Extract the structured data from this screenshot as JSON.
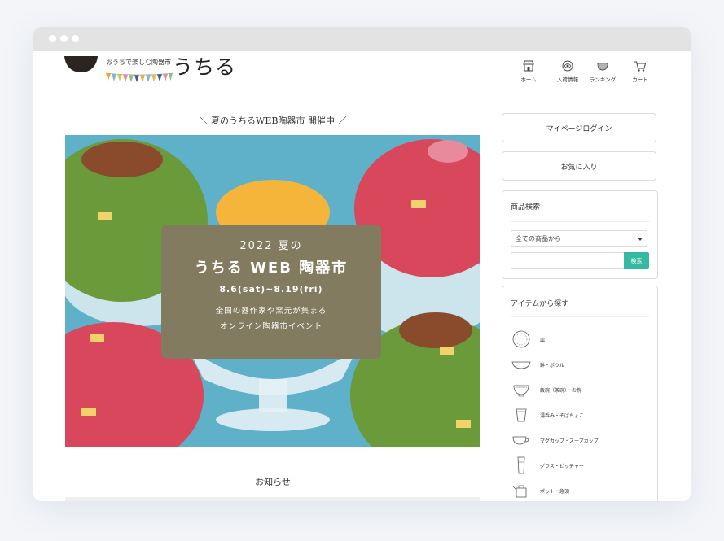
{
  "header": {
    "tagline": "おうちで楽しむ陶器市",
    "brand": "うちる",
    "nav": [
      {
        "label": "ホーム",
        "icon": "shop-icon"
      },
      {
        "label": "入荷情報",
        "icon": "box-icon"
      },
      {
        "label": "ランキング",
        "icon": "crown-bowl-icon"
      },
      {
        "label": "カート",
        "icon": "cart-icon"
      }
    ]
  },
  "main": {
    "notice": "＼ 夏のうちるWEB陶器市 開催中 ／",
    "banner": {
      "line1": "2022 夏の",
      "line2": "うちる WEB 陶器市",
      "line3": "8.6(sat)~8.19(fri)",
      "line4": "全国の器作家や窯元が集まる",
      "line5": "オンライン陶器市イベント"
    },
    "news_title": "お知らせ"
  },
  "sidebar": {
    "login": "マイページログイン",
    "favorites": "お気に入り",
    "search": {
      "title": "商品検索",
      "select_value": "全ての商品から",
      "input_value": "",
      "button": "検索"
    },
    "categories": {
      "title": "アイテムから探す",
      "items": [
        {
          "label": "皿",
          "icon": "plate-icon"
        },
        {
          "label": "鉢・ボウル",
          "icon": "bowl-icon"
        },
        {
          "label": "飯碗（茶碗）・お椀",
          "icon": "rice-bowl-icon"
        },
        {
          "label": "湯呑み・そばちょこ",
          "icon": "cup-icon"
        },
        {
          "label": "マグカップ・スープカップ",
          "icon": "mug-icon"
        },
        {
          "label": "グラス・ピッチャー",
          "icon": "glass-icon"
        },
        {
          "label": "ポット・急須",
          "icon": "pot-icon"
        }
      ]
    }
  },
  "colors": {
    "banner_bg": "#5fb0c9",
    "banner_panel": "#827b5f",
    "search_button": "#35b9a3",
    "window_bar": "#e3e3e3"
  }
}
